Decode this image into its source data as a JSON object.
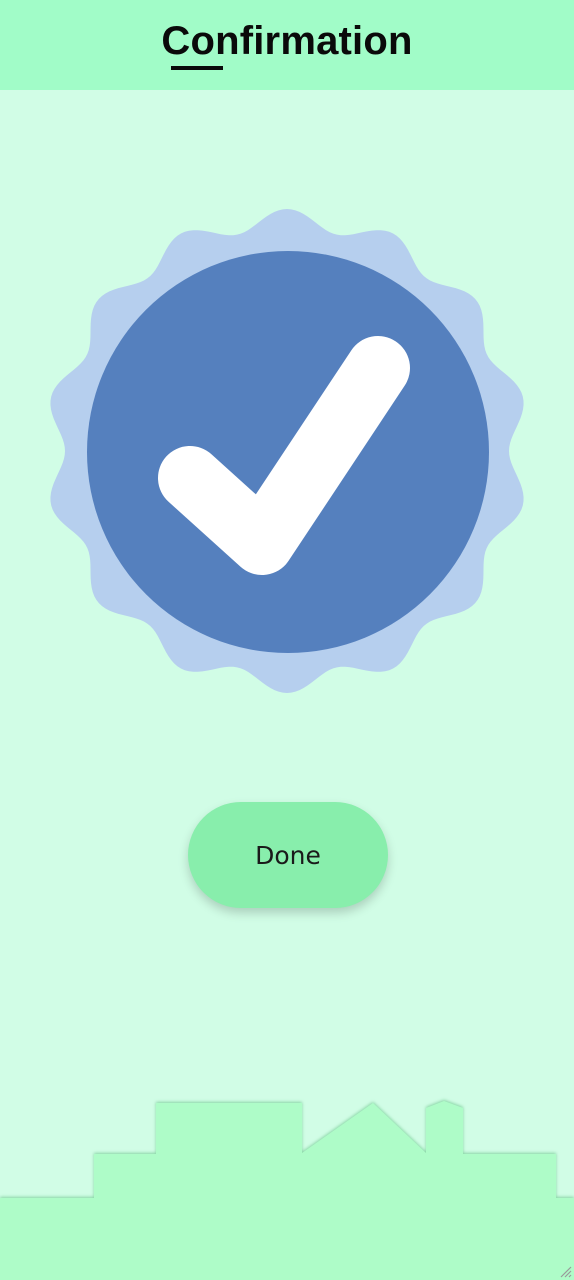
{
  "header": {
    "title": "Confirmation"
  },
  "badge": {
    "icon": "verified-check-badge-icon",
    "outer_color": "#b6cfee",
    "inner_color": "#5580be",
    "check_color": "#ffffff"
  },
  "actions": {
    "done_label": "Done"
  },
  "colors": {
    "background": "#d1fde6",
    "header": "#a1fcc8",
    "button": "#88eeac",
    "skyline": "#aefcc8"
  }
}
